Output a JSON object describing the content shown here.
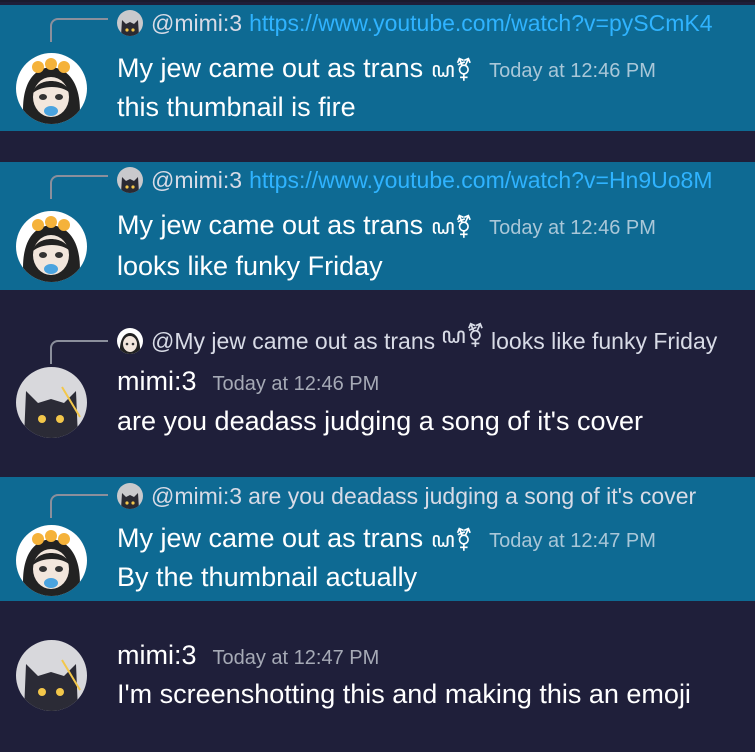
{
  "colors": {
    "highlight": "#0e6a93",
    "background": "#1f1f3a",
    "link": "#2fb3ff",
    "timestamp": "#a6aab6"
  },
  "messages": [
    {
      "highlighted": true,
      "reply_to": {
        "author": "@mimi:3",
        "text": "https://www.youtube.com/watch?v=pySCmK4",
        "is_link": true
      },
      "author": "My jew came out as trans",
      "author_badge": "ꦝ⚧",
      "timestamp": "Today at 12:46 PM",
      "text": "this thumbnail is fire",
      "avatar": "anime-girl-avatar"
    },
    {
      "highlighted": true,
      "reply_to": {
        "author": "@mimi:3",
        "text": "https://www.youtube.com/watch?v=Hn9Uo8M",
        "is_link": true
      },
      "author": "My jew came out as trans",
      "author_badge": "ꦝ⚧",
      "timestamp": "Today at 12:46 PM",
      "text": "looks like funky Friday",
      "avatar": "anime-girl-avatar"
    },
    {
      "highlighted": false,
      "reply_to": {
        "author": "@My jew came out as trans",
        "badge": "ꦝ⚧",
        "text": "looks like funky Friday",
        "is_link": false
      },
      "author": "mimi:3",
      "timestamp": "Today at 12:46 PM",
      "text": "are you deadass judging a song of it's cover",
      "avatar": "black-cat-avatar"
    },
    {
      "highlighted": true,
      "reply_to": {
        "author": "@mimi:3",
        "text": "are you deadass judging a song of it's cover",
        "is_link": false
      },
      "author": "My jew came out as trans",
      "author_badge": "ꦝ⚧",
      "timestamp": "Today at 12:47 PM",
      "text": "By the thumbnail actually",
      "avatar": "anime-girl-avatar"
    },
    {
      "highlighted": false,
      "author": "mimi:3",
      "timestamp": "Today at 12:47 PM",
      "text": "I'm screenshotting this and making this an emoji",
      "avatar": "black-cat-avatar"
    }
  ]
}
